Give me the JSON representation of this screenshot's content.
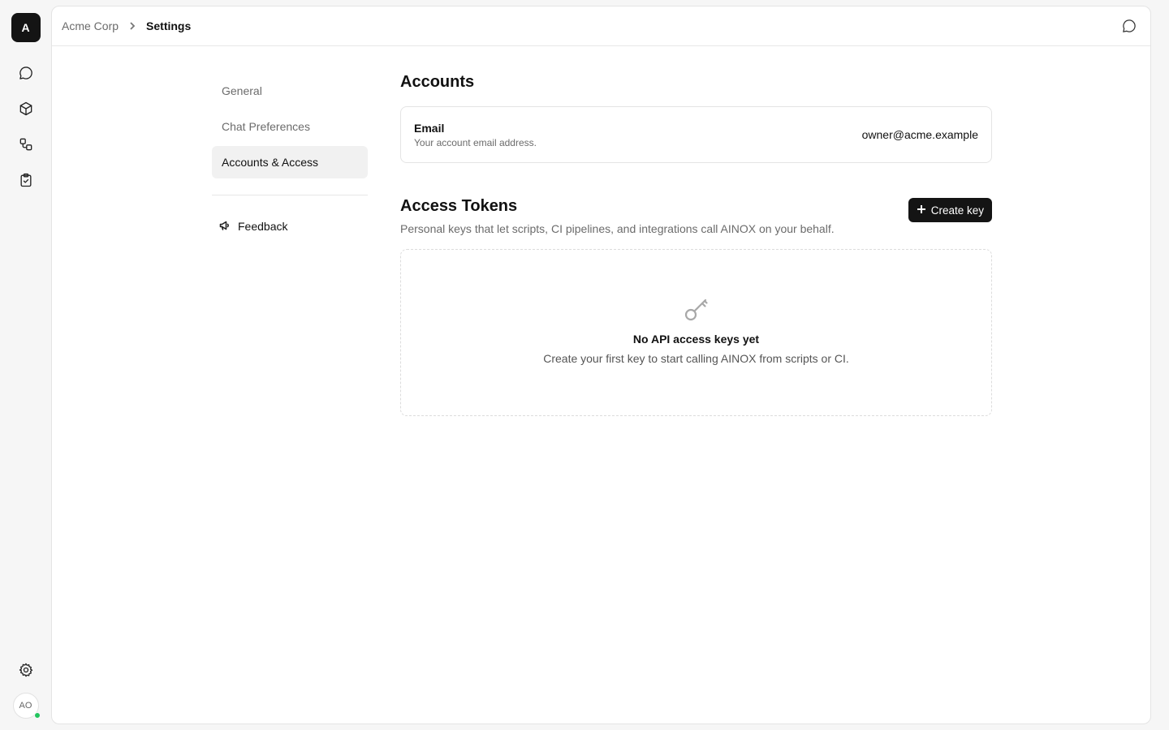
{
  "rail": {
    "workspace_initial": "A",
    "nav_icons": [
      "chat-icon",
      "cube-icon",
      "workflow-icon",
      "clipboard-check-icon"
    ],
    "settings_icon": "gear-icon",
    "user_initials": "AO",
    "presence_color": "#22c55e"
  },
  "header": {
    "breadcrumb_parent": "Acme Corp",
    "breadcrumb_current": "Settings",
    "action_icon": "chat-bubble-icon"
  },
  "settings_nav": {
    "items": [
      {
        "label": "General"
      },
      {
        "label": "Chat Preferences"
      },
      {
        "label": "Accounts & Access"
      }
    ],
    "active": "Accounts & Access",
    "feedback_label": "Feedback",
    "feedback_icon": "megaphone-icon"
  },
  "accounts": {
    "title": "Accounts",
    "email_label": "Email",
    "email_help": "Your account email address.",
    "email_value": "owner@acme.example"
  },
  "tokens": {
    "title": "Access Tokens",
    "description": "Personal keys that let scripts, CI pipelines, and integrations call AINOX on your behalf.",
    "create_label": "Create key",
    "empty_icon": "key-icon",
    "empty_title": "No API access keys yet",
    "empty_description": "Create your first key to start calling AINOX from scripts or CI."
  },
  "colors": {
    "accent": "#141414",
    "background": "#f6f6f6",
    "muted_text": "#6b6b6b"
  }
}
